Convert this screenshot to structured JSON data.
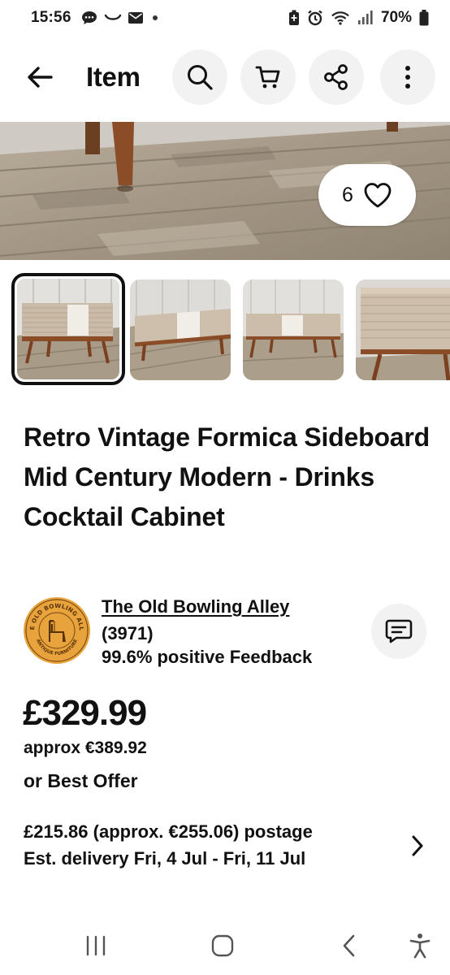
{
  "status_bar": {
    "time": "15:56",
    "battery": "70%",
    "notification_icons": [
      "chat-bubble-icon",
      "voicemail-icon",
      "mail-icon",
      "dot-icon"
    ],
    "system_icons": [
      "battery-saver-icon",
      "alarm-icon",
      "wifi-icon",
      "signal-icon",
      "battery-icon"
    ]
  },
  "header": {
    "title": "Item",
    "actions": [
      "search-icon",
      "cart-icon",
      "share-icon",
      "more-vertical-icon"
    ]
  },
  "gallery": {
    "watch_count": "6",
    "thumbnail_count": 4,
    "selected_index": 0
  },
  "product": {
    "title": "Retro Vintage Formica Sideboard Mid Century Modern - Drinks Cocktail Cabinet"
  },
  "seller": {
    "name": "The Old Bowling Alley",
    "rating_count": "(3971)",
    "feedback": "99.6% positive Feedback",
    "logo_text_top": "THE OLD BOWLING ALLEY",
    "logo_text_bottom": "ANTIQUE FURNITURE"
  },
  "pricing": {
    "price": "£329.99",
    "approx": "approx €389.92",
    "offer": "or Best Offer"
  },
  "shipping": {
    "postage": "£215.86 (approx. €255.06) postage",
    "delivery": "Est. delivery Fri, 4 Jul - Fri, 11 Jul"
  },
  "nav_bar": {
    "buttons": [
      "recents-icon",
      "home-icon",
      "back-icon",
      "accessibility-icon"
    ]
  },
  "colors": {
    "button_bg": "#f2f2f2",
    "text": "#111111",
    "logo_gold": "#e8a33c"
  }
}
